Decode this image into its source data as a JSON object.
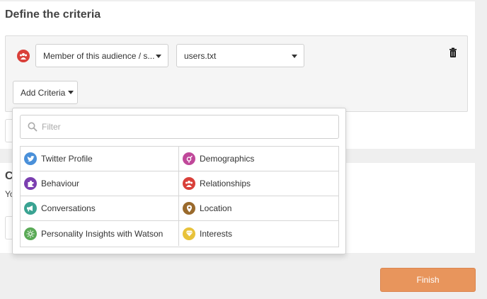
{
  "criteria": {
    "title": "Define the criteria",
    "row": {
      "type_select": "Member of this audience / s...",
      "file_select": "users.txt"
    },
    "add_button": "Add Criteria"
  },
  "dropdown": {
    "filter_placeholder": "Filter",
    "categories": [
      {
        "label": "Twitter Profile",
        "icon": "twitter-icon",
        "color": "#4a90d9"
      },
      {
        "label": "Demographics",
        "icon": "gender-icon",
        "color": "#c0489a"
      },
      {
        "label": "Behaviour",
        "icon": "puzzle-icon",
        "color": "#7b3fb0"
      },
      {
        "label": "Relationships",
        "icon": "people-icon",
        "color": "#d9403a"
      },
      {
        "label": "Conversations",
        "icon": "megaphone-icon",
        "color": "#3aa392"
      },
      {
        "label": "Location",
        "icon": "location-pin-icon",
        "color": "#9a6a2c"
      },
      {
        "label": "Personality Insights with Watson",
        "icon": "watson-icon",
        "color": "#5aaa56"
      },
      {
        "label": "Interests",
        "icon": "diamond-icon",
        "color": "#e8c23a"
      }
    ]
  },
  "bottom": {
    "title_fragment": "C",
    "text_fragment": "Yo"
  },
  "finish_label": "Finish"
}
